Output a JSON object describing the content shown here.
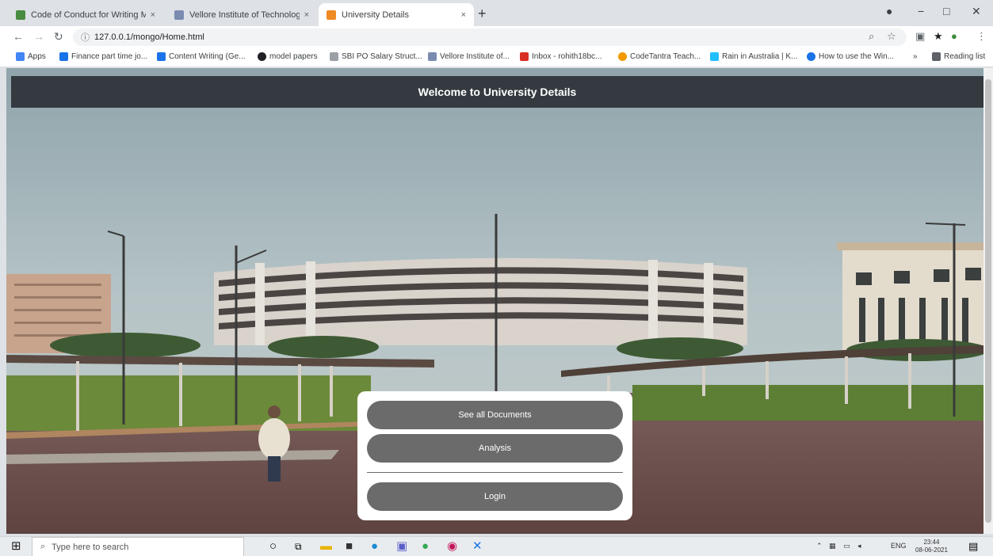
{
  "browser": {
    "tabs": [
      {
        "title": "Code of Conduct for Writing M...",
        "favicon_color": "#4a8c3f",
        "active": false
      },
      {
        "title": "Vellore Institute of Technology -",
        "favicon_color": "#7b8bb0",
        "active": false
      },
      {
        "title": "University Details",
        "favicon_color": "#f08a24",
        "active": true
      }
    ],
    "close_glyph": "×",
    "new_tab_glyph": "+",
    "url": "127.0.0.1/mongo/Home.html",
    "bookmarks": [
      {
        "label": "Apps",
        "color": "#4285f4"
      },
      {
        "label": "Finance part time jo...",
        "color": "#1a73e8"
      },
      {
        "label": "Content Writing (Ge...",
        "color": "#1a73e8"
      },
      {
        "label": "model papers",
        "color": "#202124"
      },
      {
        "label": "SBI PO Salary Struct...",
        "color": "#9aa0a6"
      },
      {
        "label": "Vellore Institute of...",
        "color": "#7b8bb0"
      },
      {
        "label": "Inbox - rohith18bc...",
        "color": "#d93025"
      },
      {
        "label": "CodeTantra Teach...",
        "color": "#f29900"
      },
      {
        "label": "Rain in Australia | K...",
        "color": "#20beff"
      },
      {
        "label": "How to use the Win...",
        "color": "#1a73e8"
      },
      {
        "label": "Reading list",
        "color": "#5f6368"
      }
    ]
  },
  "page": {
    "header_title": "Welcome to University Details",
    "menu": {
      "see_all_documents": "See all Documents",
      "analysis": "Analysis",
      "login": "Login"
    }
  },
  "taskbar": {
    "search_placeholder": "Type here to search",
    "language": "ENG",
    "time": "23:44",
    "date": "08-06-2021"
  }
}
